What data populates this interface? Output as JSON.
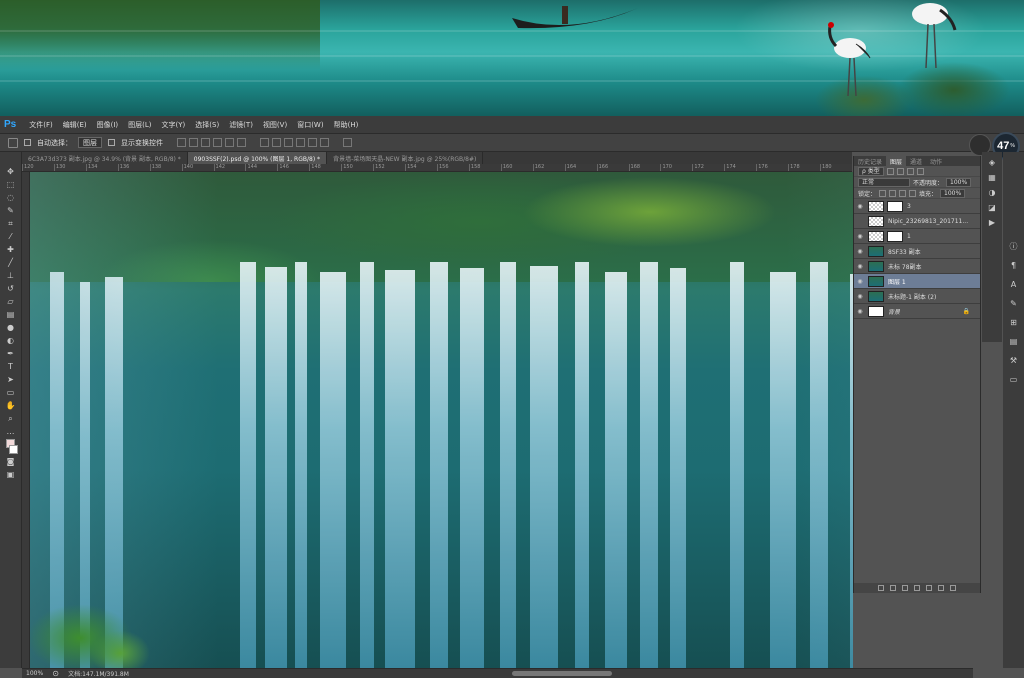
{
  "app": {
    "logo": "Ps"
  },
  "menu": [
    "文件(F)",
    "编辑(E)",
    "图像(I)",
    "图层(L)",
    "文字(Y)",
    "选择(S)",
    "滤镜(T)",
    "视图(V)",
    "窗口(W)",
    "帮助(H)"
  ],
  "options": {
    "auto_select_label": "自动选择：",
    "auto_select_value": "图层",
    "show_transform_label": "显示变换控件"
  },
  "zoom_badge": {
    "value": "47",
    "unit": "%"
  },
  "tabs": [
    "6C3A73d373 副本.jpg @ 34.9% (背景 副本, RGB/8) *",
    "0903SSF(2).psd @ 100% (图层 1, RGB/8) *",
    "背景墙-菜场图天晶-NEW 副本.jpg @ 25%(RGB/8#)"
  ],
  "ruler_ticks": [
    "120",
    "130",
    "134",
    "136",
    "138",
    "140",
    "142",
    "144",
    "146",
    "148",
    "150",
    "152",
    "154",
    "156",
    "158",
    "160",
    "162",
    "164",
    "166",
    "168",
    "170",
    "172",
    "174",
    "176",
    "178",
    "180"
  ],
  "status": {
    "zoom": "100%",
    "doc": "文档:147.1M/391.8M"
  },
  "layers_panel": {
    "tabs": [
      "历史记录",
      "图层",
      "通道",
      "动作"
    ],
    "kind_label": "类型",
    "blend_mode": "正常",
    "opacity_label": "不透明度：",
    "opacity_value": "100%",
    "lock_label": "锁定：",
    "fill_label": "填充：",
    "fill_value": "100%",
    "layers": [
      {
        "name": "3",
        "thumb": "checker",
        "mask": true,
        "visible": true,
        "selected": false
      },
      {
        "name": "Nipic_23269813_201711...",
        "thumb": "checker",
        "mask": false,
        "visible": false,
        "selected": false
      },
      {
        "name": "1",
        "thumb": "checker",
        "mask": true,
        "visible": true,
        "selected": false
      },
      {
        "name": "8SF33 副本",
        "thumb": "water",
        "mask": false,
        "visible": true,
        "selected": false
      },
      {
        "name": "未标 78副本",
        "thumb": "water",
        "mask": false,
        "visible": true,
        "selected": false
      },
      {
        "name": "图层 1",
        "thumb": "water",
        "mask": false,
        "visible": true,
        "selected": true
      },
      {
        "name": "未标题-1 副本 (2)",
        "thumb": "water",
        "mask": false,
        "visible": true,
        "selected": false
      },
      {
        "name": "背景",
        "thumb": "white",
        "mask": false,
        "visible": true,
        "selected": false,
        "locked": true
      }
    ]
  },
  "tools": [
    "move-tool",
    "marquee-tool",
    "lasso-tool",
    "quick-select-tool",
    "crop-tool",
    "eyedropper-tool",
    "healing-tool",
    "brush-tool",
    "clone-stamp-tool",
    "history-brush-tool",
    "eraser-tool",
    "gradient-tool",
    "blur-tool",
    "dodge-tool",
    "pen-tool",
    "type-tool",
    "path-select-tool",
    "shape-tool",
    "hand-tool",
    "zoom-tool"
  ]
}
